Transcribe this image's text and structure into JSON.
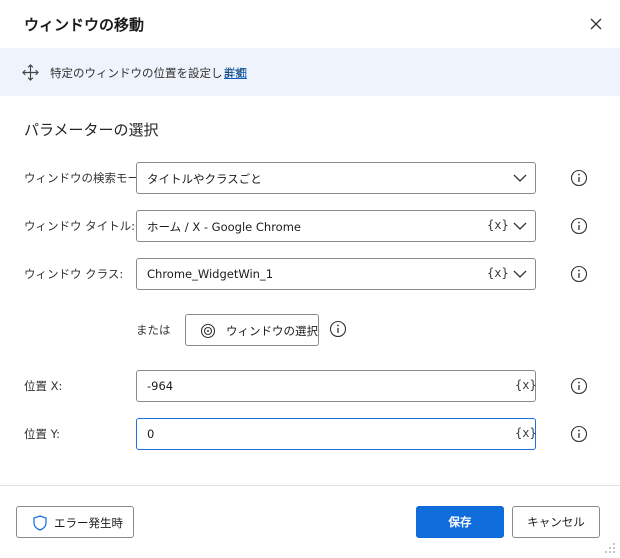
{
  "dialog": {
    "title": "ウィンドウの移動"
  },
  "info": {
    "text": "特定のウィンドウの位置を設定します",
    "details_link": "詳細"
  },
  "section_title": "パラメーターの選択",
  "fields": {
    "search_mode": {
      "label": "ウィンドウの検索モード:",
      "value": "タイトルやクラスごと"
    },
    "window_title": {
      "label": "ウィンドウ タイトル:",
      "value": "ホーム / X - Google Chrome",
      "var_token": "{x}"
    },
    "window_class": {
      "label": "ウィンドウ クラス:",
      "value": "Chrome_WidgetWin_1",
      "var_token": "{x}"
    },
    "position_x": {
      "label": "位置 X:",
      "value": "-964",
      "var_token": "{x}"
    },
    "position_y": {
      "label": "位置 Y:",
      "value": "0",
      "var_token": "{x}"
    }
  },
  "or_select": {
    "or_label": "または",
    "button_label": "ウィンドウの選択"
  },
  "footer": {
    "on_error_label": "エラー発生時",
    "save_label": "保存",
    "cancel_label": "キャンセル"
  },
  "colors": {
    "accent": "#0f6cdb",
    "info_bar_bg": "#eff3fb",
    "link": "#0f5db8",
    "focus_border": "#1f6ee0"
  }
}
